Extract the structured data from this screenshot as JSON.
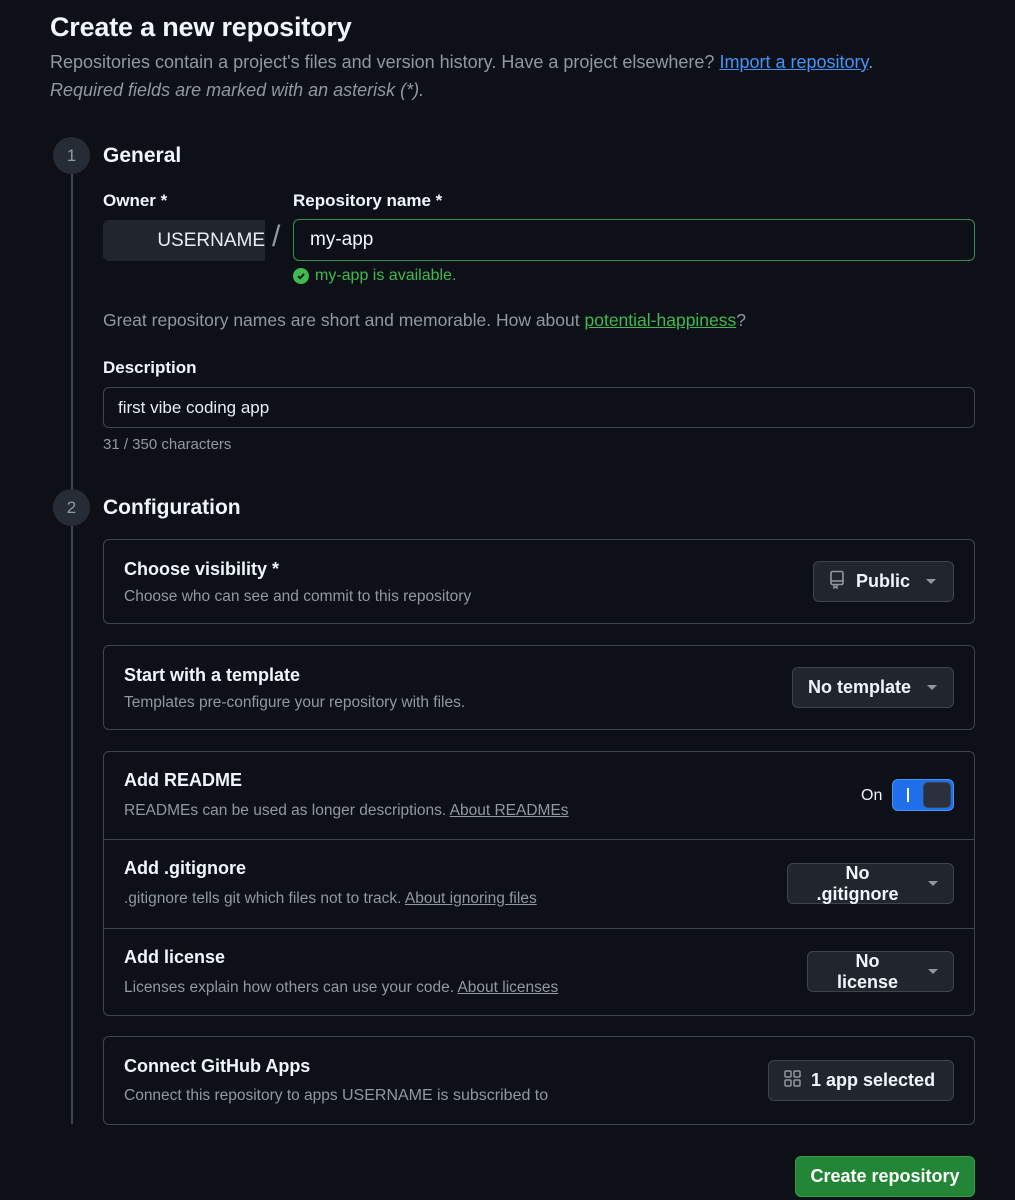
{
  "header": {
    "title": "Create a new repository",
    "subtitle": "Repositories contain a project's files and version history. Have a project elsewhere?",
    "import_link": "Import a repository",
    "required_note": "Required fields are marked with an asterisk (*)."
  },
  "general": {
    "step_number": "1",
    "title": "General",
    "owner_label": "Owner *",
    "owner_value": "USERNAME",
    "slash": "/",
    "repo_name_label": "Repository name *",
    "repo_name_value": "my-app",
    "availability": "my-app is available.",
    "suggestion_prefix": "Great repository names are short and memorable. How about",
    "suggestion_name": "potential-happiness",
    "suggestion_suffix": "?",
    "description_label": "Description",
    "description_value": "first vibe coding app",
    "char_count": "31 / 350 characters"
  },
  "configuration": {
    "step_number": "2",
    "title": "Configuration",
    "visibility": {
      "title": "Choose visibility *",
      "description": "Choose who can see and commit to this repository",
      "selected": "Public"
    },
    "template": {
      "title": "Start with a template",
      "description": "Templates pre-configure your repository with files.",
      "selected": "No template"
    },
    "readme": {
      "title": "Add README",
      "description": "READMEs can be used as longer descriptions.",
      "link": "About READMEs",
      "toggle_label": "On",
      "enabled": true
    },
    "gitignore": {
      "title": "Add .gitignore",
      "description": ".gitignore tells git which files not to track.",
      "link": "About ignoring files",
      "selected": "No .gitignore"
    },
    "license": {
      "title": "Add license",
      "description": "Licenses explain how others can use your code.",
      "link": "About licenses",
      "selected": "No license"
    },
    "apps": {
      "title": "Connect GitHub Apps",
      "description": "Connect this repository to apps",
      "username": "USERNAME",
      "description_suffix": "is subscribed to",
      "selected": "1 app selected"
    }
  },
  "actions": {
    "create_label": "Create repository"
  },
  "colors": {
    "background": "#0d1117",
    "accent_green": "#238636",
    "link_blue": "#4493f8",
    "success_green": "#3fb950",
    "toggle_blue": "#1f6feb"
  }
}
